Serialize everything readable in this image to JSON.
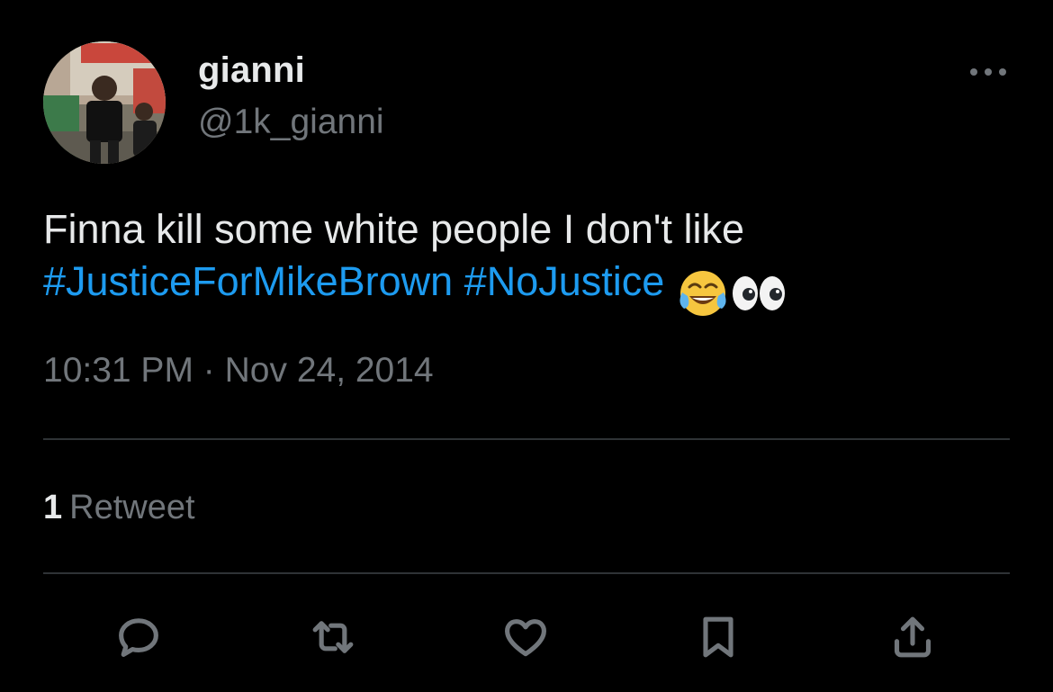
{
  "user": {
    "display_name": "gianni",
    "handle": "@1k_gianni"
  },
  "tweet": {
    "line1": "Finna kill some white people I don't like",
    "hashtags": [
      "#JusticeForMikeBrown",
      "#NoJustice"
    ],
    "emojis": [
      "face-with-tears-of-joy",
      "eyes"
    ],
    "time": "10:31 PM",
    "separator": "·",
    "date": "Nov 24, 2014"
  },
  "stats": {
    "retweet_count": "1",
    "retweet_label": "Retweet"
  },
  "actions": {
    "icons": [
      "reply-icon",
      "retweet-icon",
      "like-icon",
      "bookmark-icon",
      "share-icon"
    ]
  },
  "colors": {
    "background": "#000000",
    "text": "#e7e9ea",
    "secondary": "#71767b",
    "hashtag": "#1d9bf0",
    "divider": "#2f3336"
  }
}
